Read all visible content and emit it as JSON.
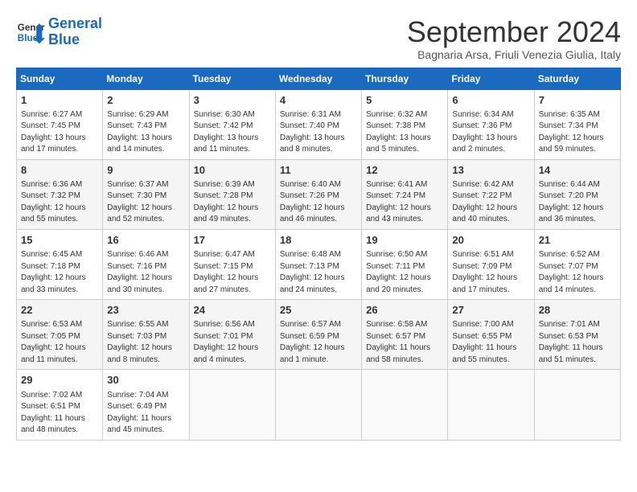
{
  "header": {
    "logo_line1": "General",
    "logo_line2": "Blue",
    "month_title": "September 2024",
    "subtitle": "Bagnaria Arsa, Friuli Venezia Giulia, Italy"
  },
  "weekdays": [
    "Sunday",
    "Monday",
    "Tuesday",
    "Wednesday",
    "Thursday",
    "Friday",
    "Saturday"
  ],
  "weeks": [
    [
      {
        "day": "1",
        "info": "Sunrise: 6:27 AM\nSunset: 7:45 PM\nDaylight: 13 hours and 17 minutes."
      },
      {
        "day": "2",
        "info": "Sunrise: 6:29 AM\nSunset: 7:43 PM\nDaylight: 13 hours and 14 minutes."
      },
      {
        "day": "3",
        "info": "Sunrise: 6:30 AM\nSunset: 7:42 PM\nDaylight: 13 hours and 11 minutes."
      },
      {
        "day": "4",
        "info": "Sunrise: 6:31 AM\nSunset: 7:40 PM\nDaylight: 13 hours and 8 minutes."
      },
      {
        "day": "5",
        "info": "Sunrise: 6:32 AM\nSunset: 7:38 PM\nDaylight: 13 hours and 5 minutes."
      },
      {
        "day": "6",
        "info": "Sunrise: 6:34 AM\nSunset: 7:36 PM\nDaylight: 13 hours and 2 minutes."
      },
      {
        "day": "7",
        "info": "Sunrise: 6:35 AM\nSunset: 7:34 PM\nDaylight: 12 hours and 59 minutes."
      }
    ],
    [
      {
        "day": "8",
        "info": "Sunrise: 6:36 AM\nSunset: 7:32 PM\nDaylight: 12 hours and 55 minutes."
      },
      {
        "day": "9",
        "info": "Sunrise: 6:37 AM\nSunset: 7:30 PM\nDaylight: 12 hours and 52 minutes."
      },
      {
        "day": "10",
        "info": "Sunrise: 6:39 AM\nSunset: 7:28 PM\nDaylight: 12 hours and 49 minutes."
      },
      {
        "day": "11",
        "info": "Sunrise: 6:40 AM\nSunset: 7:26 PM\nDaylight: 12 hours and 46 minutes."
      },
      {
        "day": "12",
        "info": "Sunrise: 6:41 AM\nSunset: 7:24 PM\nDaylight: 12 hours and 43 minutes."
      },
      {
        "day": "13",
        "info": "Sunrise: 6:42 AM\nSunset: 7:22 PM\nDaylight: 12 hours and 40 minutes."
      },
      {
        "day": "14",
        "info": "Sunrise: 6:44 AM\nSunset: 7:20 PM\nDaylight: 12 hours and 36 minutes."
      }
    ],
    [
      {
        "day": "15",
        "info": "Sunrise: 6:45 AM\nSunset: 7:18 PM\nDaylight: 12 hours and 33 minutes."
      },
      {
        "day": "16",
        "info": "Sunrise: 6:46 AM\nSunset: 7:16 PM\nDaylight: 12 hours and 30 minutes."
      },
      {
        "day": "17",
        "info": "Sunrise: 6:47 AM\nSunset: 7:15 PM\nDaylight: 12 hours and 27 minutes."
      },
      {
        "day": "18",
        "info": "Sunrise: 6:48 AM\nSunset: 7:13 PM\nDaylight: 12 hours and 24 minutes."
      },
      {
        "day": "19",
        "info": "Sunrise: 6:50 AM\nSunset: 7:11 PM\nDaylight: 12 hours and 20 minutes."
      },
      {
        "day": "20",
        "info": "Sunrise: 6:51 AM\nSunset: 7:09 PM\nDaylight: 12 hours and 17 minutes."
      },
      {
        "day": "21",
        "info": "Sunrise: 6:52 AM\nSunset: 7:07 PM\nDaylight: 12 hours and 14 minutes."
      }
    ],
    [
      {
        "day": "22",
        "info": "Sunrise: 6:53 AM\nSunset: 7:05 PM\nDaylight: 12 hours and 11 minutes."
      },
      {
        "day": "23",
        "info": "Sunrise: 6:55 AM\nSunset: 7:03 PM\nDaylight: 12 hours and 8 minutes."
      },
      {
        "day": "24",
        "info": "Sunrise: 6:56 AM\nSunset: 7:01 PM\nDaylight: 12 hours and 4 minutes."
      },
      {
        "day": "25",
        "info": "Sunrise: 6:57 AM\nSunset: 6:59 PM\nDaylight: 12 hours and 1 minute."
      },
      {
        "day": "26",
        "info": "Sunrise: 6:58 AM\nSunset: 6:57 PM\nDaylight: 11 hours and 58 minutes."
      },
      {
        "day": "27",
        "info": "Sunrise: 7:00 AM\nSunset: 6:55 PM\nDaylight: 11 hours and 55 minutes."
      },
      {
        "day": "28",
        "info": "Sunrise: 7:01 AM\nSunset: 6:53 PM\nDaylight: 11 hours and 51 minutes."
      }
    ],
    [
      {
        "day": "29",
        "info": "Sunrise: 7:02 AM\nSunset: 6:51 PM\nDaylight: 11 hours and 48 minutes."
      },
      {
        "day": "30",
        "info": "Sunrise: 7:04 AM\nSunset: 6:49 PM\nDaylight: 11 hours and 45 minutes."
      },
      {
        "day": "",
        "info": ""
      },
      {
        "day": "",
        "info": ""
      },
      {
        "day": "",
        "info": ""
      },
      {
        "day": "",
        "info": ""
      },
      {
        "day": "",
        "info": ""
      }
    ]
  ]
}
